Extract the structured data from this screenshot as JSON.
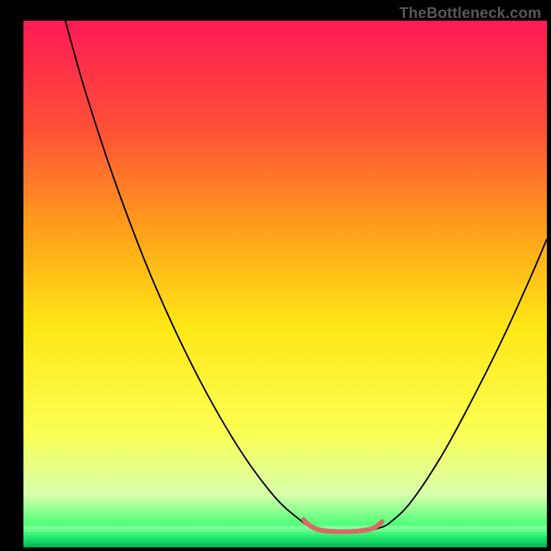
{
  "watermark": "TheBottleneck.com",
  "chart_data": {
    "type": "line",
    "title": "",
    "xlabel": "",
    "ylabel": "",
    "xlim": [
      0,
      100
    ],
    "ylim": [
      0,
      100
    ],
    "gradient_stops": [
      {
        "offset": 0.0,
        "color": "#ff1a55"
      },
      {
        "offset": 0.2,
        "color": "#ff4e38"
      },
      {
        "offset": 0.4,
        "color": "#ffa11a"
      },
      {
        "offset": 0.58,
        "color": "#ffe715"
      },
      {
        "offset": 0.78,
        "color": "#fbff52"
      },
      {
        "offset": 0.9,
        "color": "#d9ffac"
      },
      {
        "offset": 0.955,
        "color": "#54ff7a"
      },
      {
        "offset": 1.0,
        "color": "#00e868"
      }
    ],
    "green_bands": [
      {
        "y": 96.0,
        "color": "#8cff9e"
      },
      {
        "y": 96.6,
        "color": "#66ff8c"
      },
      {
        "y": 97.2,
        "color": "#40f57a"
      },
      {
        "y": 97.8,
        "color": "#2ae86f"
      },
      {
        "y": 98.4,
        "color": "#18d864"
      },
      {
        "y": 99.0,
        "color": "#10c85c"
      },
      {
        "y": 99.5,
        "color": "#0ab853"
      }
    ],
    "series": [
      {
        "name": "bottleneck-curve",
        "color": "#000000",
        "points": [
          {
            "x": 8,
            "y": 0
          },
          {
            "x": 12,
            "y": 14
          },
          {
            "x": 18,
            "y": 32
          },
          {
            "x": 25,
            "y": 50
          },
          {
            "x": 33,
            "y": 67
          },
          {
            "x": 41,
            "y": 81
          },
          {
            "x": 48,
            "y": 90.5
          },
          {
            "x": 53,
            "y": 95.0
          },
          {
            "x": 55,
            "y": 96.3
          },
          {
            "x": 57,
            "y": 96.8
          },
          {
            "x": 60,
            "y": 97.0
          },
          {
            "x": 63,
            "y": 97.0
          },
          {
            "x": 66,
            "y": 96.8
          },
          {
            "x": 68,
            "y": 96.4
          },
          {
            "x": 70,
            "y": 95.4
          },
          {
            "x": 74,
            "y": 91.5
          },
          {
            "x": 80,
            "y": 82.5
          },
          {
            "x": 86,
            "y": 71.5
          },
          {
            "x": 92,
            "y": 59.5
          },
          {
            "x": 97,
            "y": 48.5
          },
          {
            "x": 100,
            "y": 41.5
          }
        ]
      },
      {
        "name": "optimal-marker",
        "color": "#d96a6a",
        "stroke_width": 7,
        "points": [
          {
            "x": 53.5,
            "y": 94.8
          },
          {
            "x": 54.5,
            "y": 95.8
          },
          {
            "x": 56.0,
            "y": 96.6
          },
          {
            "x": 58.0,
            "y": 97.0
          },
          {
            "x": 60.0,
            "y": 97.1
          },
          {
            "x": 62.0,
            "y": 97.1
          },
          {
            "x": 64.0,
            "y": 97.0
          },
          {
            "x": 66.0,
            "y": 96.7
          },
          {
            "x": 67.5,
            "y": 96.1
          },
          {
            "x": 68.5,
            "y": 95.2
          }
        ]
      }
    ]
  }
}
